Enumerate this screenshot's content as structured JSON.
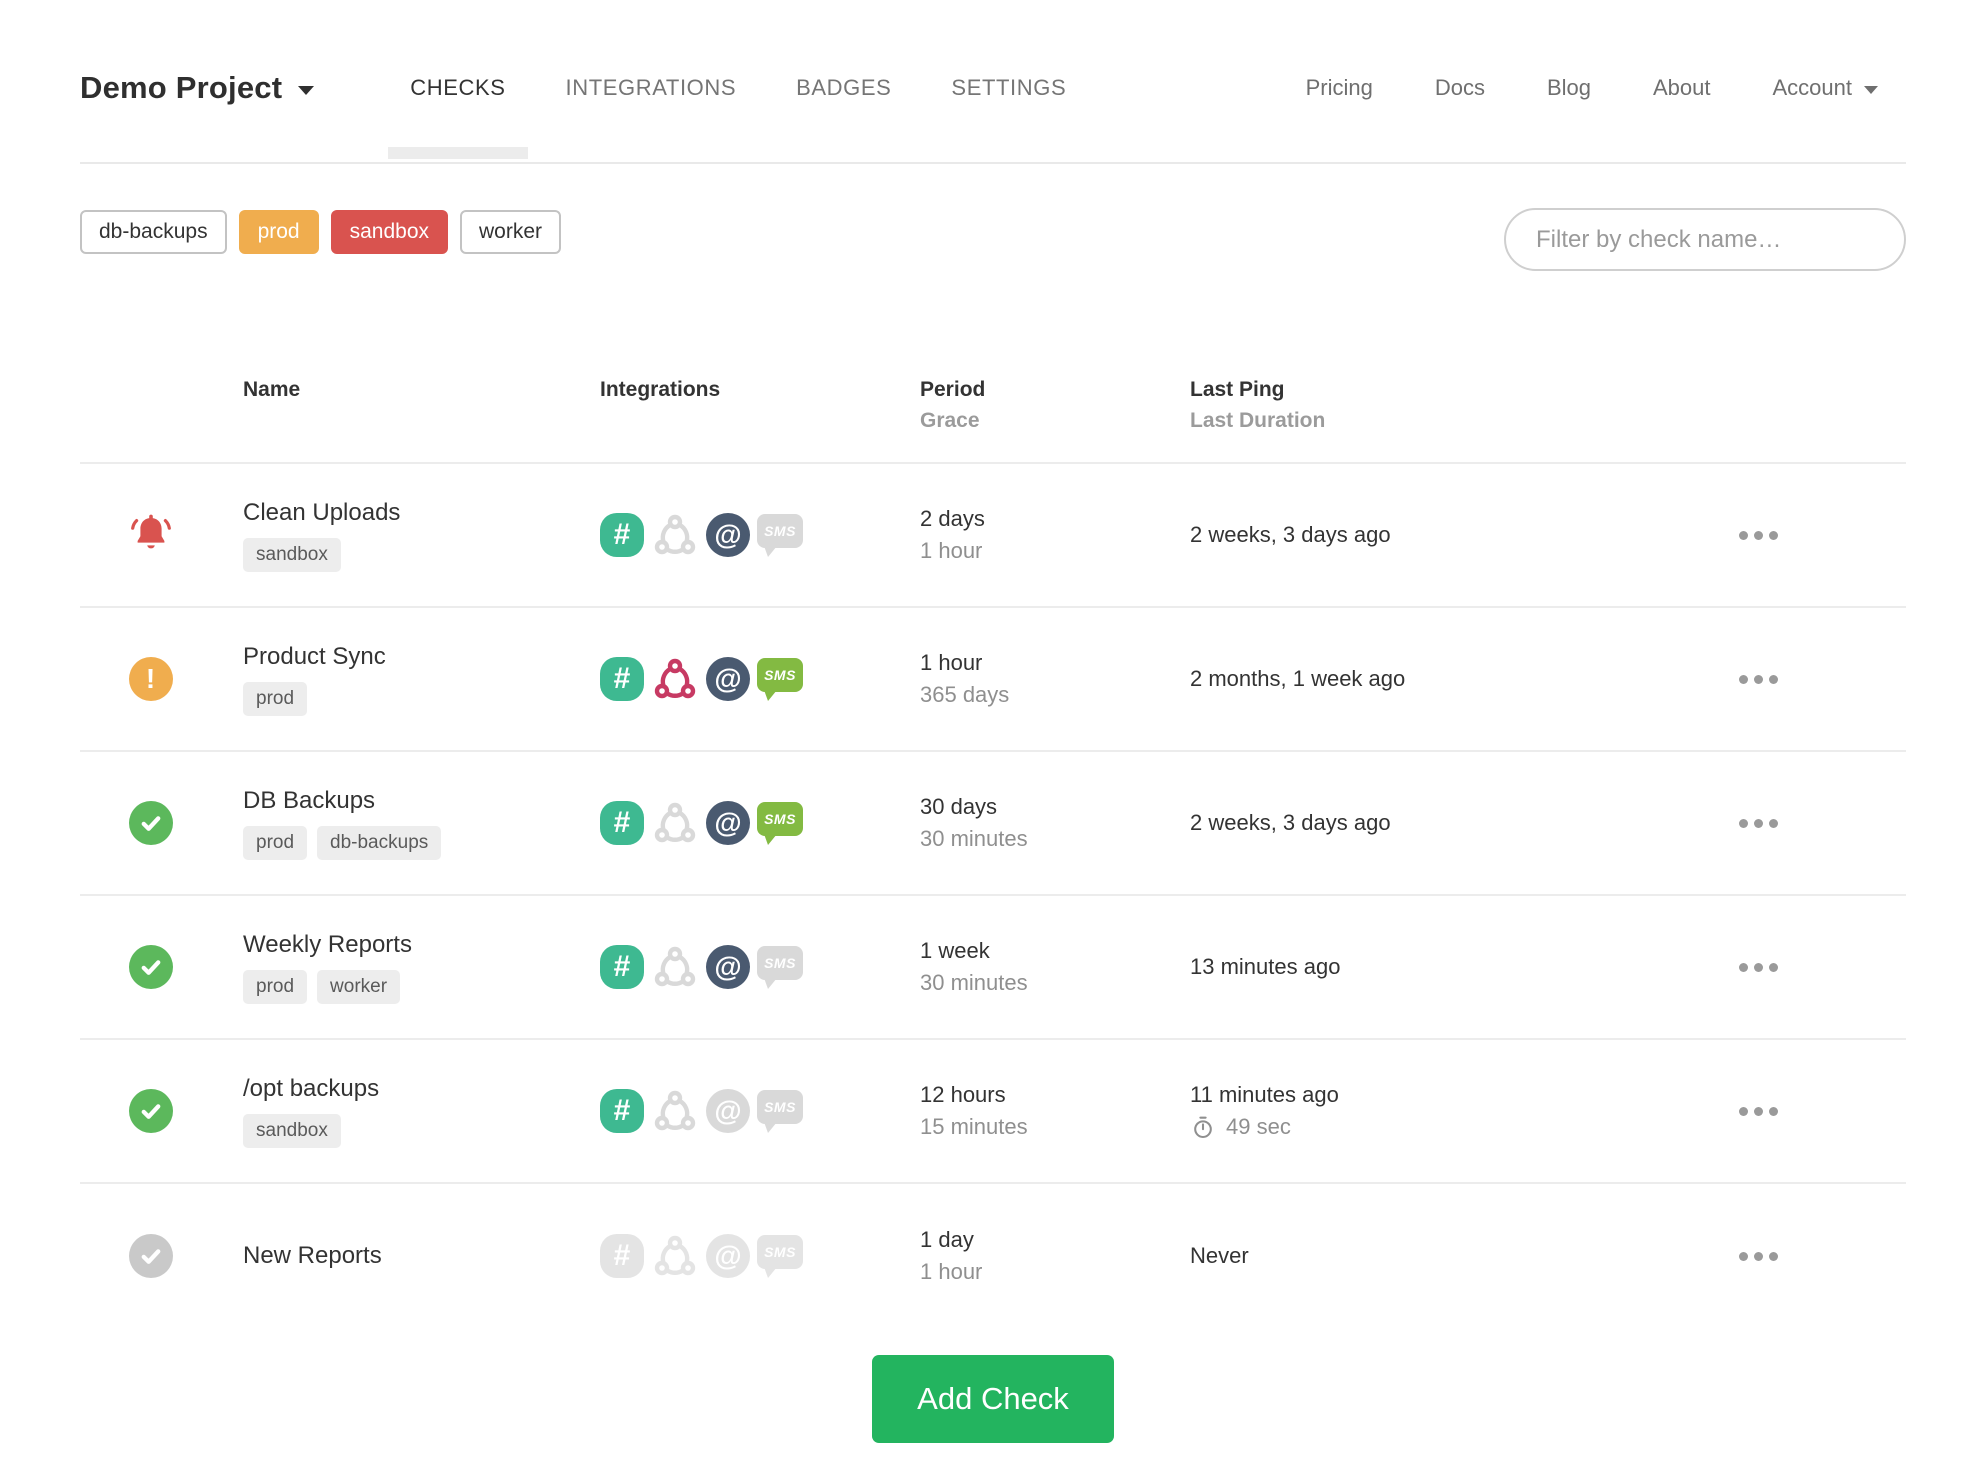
{
  "navbar": {
    "brand": "Demo Project",
    "tabs": [
      {
        "label": "CHECKS",
        "active": "active"
      },
      {
        "label": "INTEGRATIONS",
        "active": ""
      },
      {
        "label": "BADGES",
        "active": ""
      },
      {
        "label": "SETTINGS",
        "active": ""
      }
    ],
    "links": [
      "Pricing",
      "Docs",
      "Blog",
      "About"
    ],
    "account_label": "Account"
  },
  "filters": {
    "tags": [
      {
        "label": "db-backups",
        "style": "plain"
      },
      {
        "label": "prod",
        "style": "orange"
      },
      {
        "label": "sandbox",
        "style": "red"
      },
      {
        "label": "worker",
        "style": "plain"
      }
    ],
    "search_placeholder": "Filter by check name…"
  },
  "table": {
    "headers": {
      "name": "Name",
      "integrations": "Integrations",
      "period": "Period",
      "grace": "Grace",
      "last_ping": "Last Ping",
      "last_duration": "Last Duration"
    },
    "rows": [
      {
        "status": "down",
        "name": "Clean Uploads",
        "tags": [
          "sandbox"
        ],
        "integrations": {
          "slack": "on",
          "webhook": "off",
          "email": "on",
          "sms": "off"
        },
        "period": "2 days",
        "grace": "1 hour",
        "last_ping": "2 weeks, 3 days ago",
        "last_duration": ""
      },
      {
        "status": "grace",
        "name": "Product Sync",
        "tags": [
          "prod"
        ],
        "integrations": {
          "slack": "on",
          "webhook": "on",
          "email": "on",
          "sms": "on"
        },
        "period": "1 hour",
        "grace": "365 days",
        "last_ping": "2 months, 1 week ago",
        "last_duration": ""
      },
      {
        "status": "up",
        "name": "DB Backups",
        "tags": [
          "prod",
          "db-backups"
        ],
        "integrations": {
          "slack": "on",
          "webhook": "off",
          "email": "on",
          "sms": "on"
        },
        "period": "30 days",
        "grace": "30 minutes",
        "last_ping": "2 weeks, 3 days ago",
        "last_duration": ""
      },
      {
        "status": "up",
        "name": "Weekly Reports",
        "tags": [
          "prod",
          "worker"
        ],
        "integrations": {
          "slack": "on",
          "webhook": "off",
          "email": "on",
          "sms": "off"
        },
        "period": "1 week",
        "grace": "30 minutes",
        "last_ping": "13 minutes ago",
        "last_duration": ""
      },
      {
        "status": "up",
        "name": "/opt backups",
        "tags": [
          "sandbox"
        ],
        "integrations": {
          "slack": "on",
          "webhook": "off",
          "email": "off",
          "sms": "off"
        },
        "period": "12 hours",
        "grace": "15 minutes",
        "last_ping": "11 minutes ago",
        "last_duration": "49 sec"
      },
      {
        "status": "new",
        "name": "New Reports",
        "tags": [],
        "integrations": {
          "slack": "pale",
          "webhook": "pale",
          "email": "pale",
          "sms": "pale"
        },
        "period": "1 day",
        "grace": "1 hour",
        "last_ping": "Never",
        "last_duration": ""
      }
    ]
  },
  "add_check_label": "Add Check",
  "colors": {
    "danger": "#d9534f",
    "warning": "#f0ad4e",
    "success": "#5cb85c",
    "new_gray": "#c9c9c9",
    "slack_green": "#3eb991",
    "webhook_red": "#c73a63",
    "email_navy": "#4a5a70",
    "sms_green": "#83ba42",
    "add_button_green": "#23b45f"
  }
}
